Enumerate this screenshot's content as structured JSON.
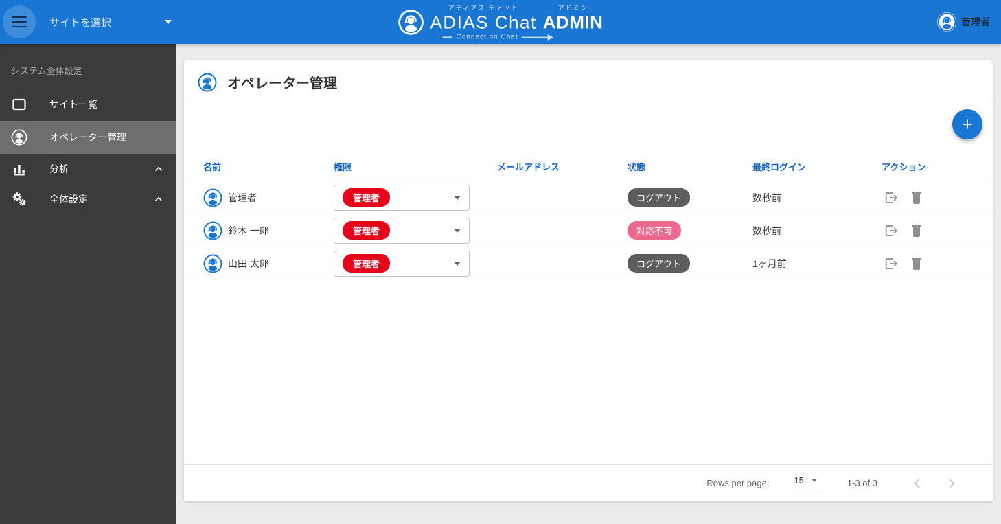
{
  "header": {
    "site_select_label": "サイトを選択",
    "logo": {
      "furigana_main": "アディアス チャット",
      "furigana_admin": "アドミン",
      "brand_main": "ADIAS Chat",
      "brand_admin": "ADMIN",
      "tagline": "Connect on Chat"
    },
    "user_name": "管理者"
  },
  "sidebar": {
    "section_label": "システム全体設定",
    "items": [
      {
        "label": "サイト一覧"
      },
      {
        "label": "オペレーター管理"
      },
      {
        "label": "分析"
      },
      {
        "label": "全体設定"
      }
    ]
  },
  "main": {
    "page_title": "オペレーター管理",
    "add_button_label": "+",
    "table": {
      "columns": [
        "名前",
        "権限",
        "メールアドレス",
        "状態",
        "最終ログイン",
        "アクション"
      ],
      "rows": [
        {
          "name": "管理者",
          "role": "管理者",
          "email": "",
          "status": "ログアウト",
          "last_login": "数秒前"
        },
        {
          "name": "鈴木 一郎",
          "role": "管理者",
          "email": "",
          "status": "対応不可",
          "last_login": "数秒前"
        },
        {
          "name": "山田 太郎",
          "role": "管理者",
          "email": "",
          "status": "ログアウト",
          "last_login": "1ヶ月前"
        }
      ]
    },
    "pagination": {
      "rows_per_page_label": "Rows per page:",
      "rows_per_page_value": "15",
      "range_label": "1-3 of 3"
    }
  },
  "colors": {
    "header_blue": "#1976d2",
    "badge_red": "#e60019",
    "status_logout_bg": "#5d5d5d",
    "status_unavailable_bg": "#ec6a8f",
    "sidebar_bg": "#3b3b3b",
    "sidebar_active_bg": "#6e6e6e",
    "table_header_text": "#1565c0"
  }
}
